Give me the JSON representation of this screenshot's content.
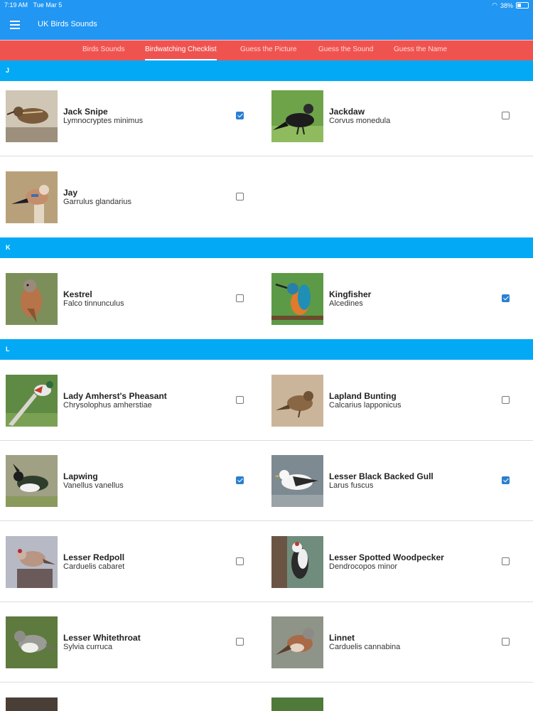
{
  "status": {
    "time": "7:19 AM",
    "date": "Tue Mar 5",
    "battery": "38%"
  },
  "app": {
    "title": "UK Birds Sounds"
  },
  "tabs": [
    "Birds Sounds",
    "Birdwatching Checklist",
    "Guess the Picture",
    "Guess the Sound",
    "Guess the Name"
  ],
  "active_tab": "Birdwatching Checklist",
  "sections": [
    {
      "letter": "J",
      "birds": [
        {
          "name": "Jack Snipe",
          "latin": "Lymnocryptes minimus",
          "checked": true
        },
        {
          "name": "Jackdaw",
          "latin": "Corvus monedula",
          "checked": false
        },
        {
          "name": "Jay",
          "latin": "Garrulus glandarius",
          "checked": false
        }
      ]
    },
    {
      "letter": "K",
      "birds": [
        {
          "name": "Kestrel",
          "latin": "Falco tinnunculus",
          "checked": false
        },
        {
          "name": "Kingfisher",
          "latin": "Alcedines",
          "checked": true
        }
      ]
    },
    {
      "letter": "L",
      "birds": [
        {
          "name": "Lady Amherst's Pheasant",
          "latin": "Chrysolophus amherstiae",
          "checked": false
        },
        {
          "name": "Lapland Bunting",
          "latin": "Calcarius lapponicus",
          "checked": false
        },
        {
          "name": "Lapwing",
          "latin": "Vanellus vanellus",
          "checked": true
        },
        {
          "name": "Lesser Black Backed Gull",
          "latin": "Larus fuscus",
          "checked": true
        },
        {
          "name": "Lesser Redpoll",
          "latin": "Carduelis cabaret",
          "checked": false
        },
        {
          "name": "Lesser Spotted Woodpecker",
          "latin": "Dendrocopos minor",
          "checked": false
        },
        {
          "name": "Lesser Whitethroat",
          "latin": "Sylvia curruca",
          "checked": false
        },
        {
          "name": "Linnet",
          "latin": "Carduelis cannabina",
          "checked": false
        }
      ]
    }
  ],
  "colors": {
    "appbar": "#2196f3",
    "tabbar": "#ef5350",
    "section": "#03a9f4",
    "checkbox": "#2b7fd0"
  }
}
